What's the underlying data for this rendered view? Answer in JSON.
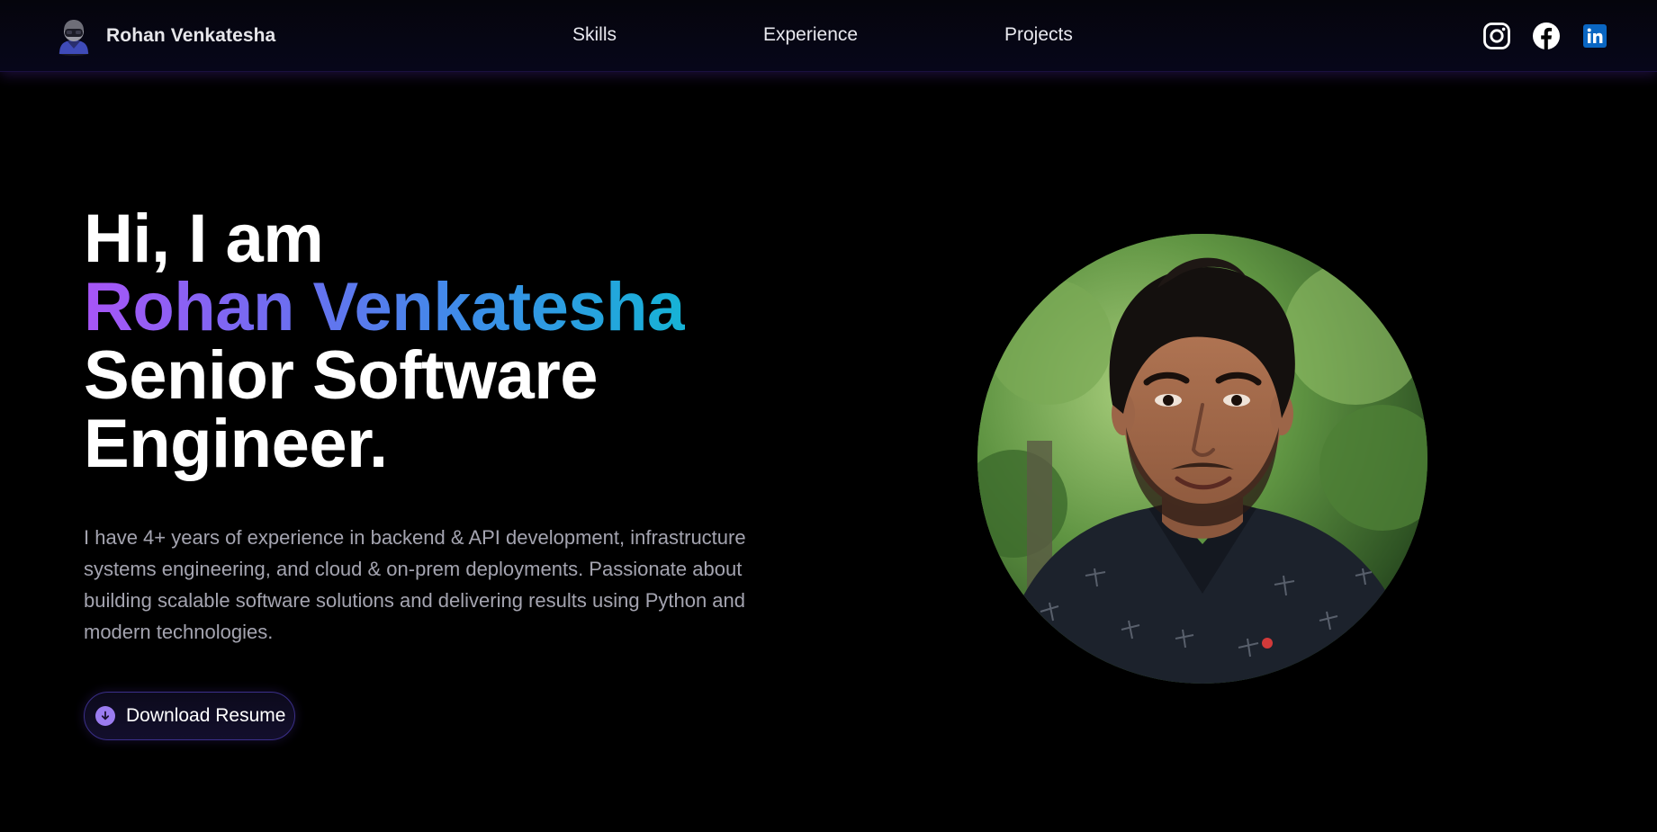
{
  "nav": {
    "brand_name": "Rohan Venkatesha",
    "brand_icon": "hacker-avatar-icon",
    "links": [
      {
        "label": "Skills"
      },
      {
        "label": "Experience"
      },
      {
        "label": "Projects"
      }
    ],
    "social": [
      {
        "name": "instagram-icon"
      },
      {
        "name": "facebook-icon"
      },
      {
        "name": "linkedin-icon"
      }
    ]
  },
  "hero": {
    "greeting": "Hi, I am",
    "name": "Rohan Venkatesha",
    "role_line1": "Senior Software",
    "role_line2": "Engineer.",
    "bio": "I have 4+ years of experience in backend & API development, infrastructure systems engineering, and cloud & on-prem deployments. Passionate about building scalable software solutions and delivering results using Python and modern technologies.",
    "resume_button": "Download Resume",
    "resume_icon": "download-arrow-icon",
    "portrait": "profile-photo"
  },
  "colors": {
    "background": "#000000",
    "name_gradient_start": "#a855f7",
    "name_gradient_end": "#16b3d6",
    "body_text": "#a4a4b0",
    "button_border": "#3b2f8a",
    "button_icon": "#9b7cf0",
    "linkedin_blue": "#0a66c2"
  }
}
